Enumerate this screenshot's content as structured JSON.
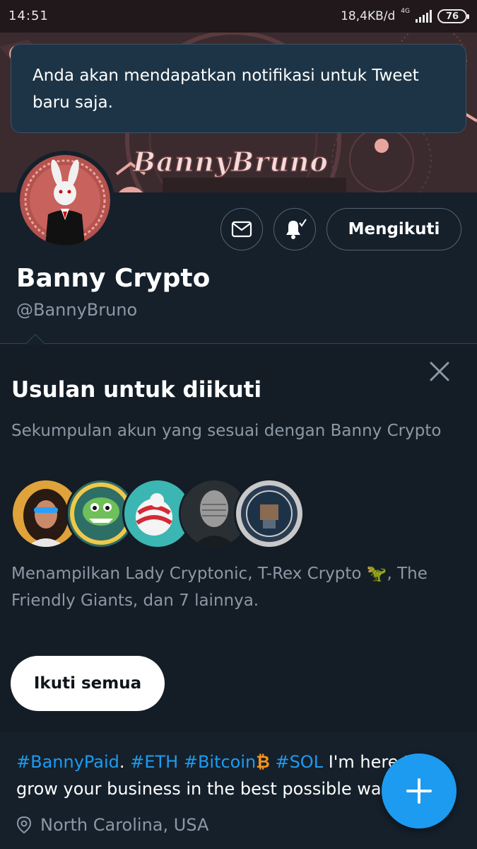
{
  "status_bar": {
    "time": "14:51",
    "net_speed": "18,4KB/d",
    "network_type": "4G",
    "battery": "76"
  },
  "banner": {
    "logo_text": "BannyBruno"
  },
  "toast": {
    "message": "Anda akan mendapatkan notifikasi untuk Tweet baru saja."
  },
  "profile": {
    "display_name": "Banny Crypto",
    "handle": "@BannyBruno",
    "follow_button": "Mengikuti"
  },
  "suggestions": {
    "title": "Usulan untuk diikuti",
    "subtitle": "Sekumpulan akun yang sesuai dengan Banny Crypto",
    "showing": "Menampilkan Lady Cryptonic, T-Rex Crypto 🦖, The Friendly Giants, dan 7 lainnya.",
    "follow_all": "Ikuti semua"
  },
  "bio": {
    "tag1": "#BannyPaid",
    "dot": ".",
    "tag2": "#ETH",
    "tag3": "#Bitcoin",
    "btc_symbol": "₿",
    "tag4": "#SOL",
    "text1": "I'm here to",
    "text2": "grow your business in the best possible way"
  },
  "location": "North Carolina, USA",
  "colors": {
    "background": "#15202b",
    "accent": "#1d9bf0",
    "secondary_text": "#8b98a5",
    "bitcoin": "#f7931a"
  }
}
